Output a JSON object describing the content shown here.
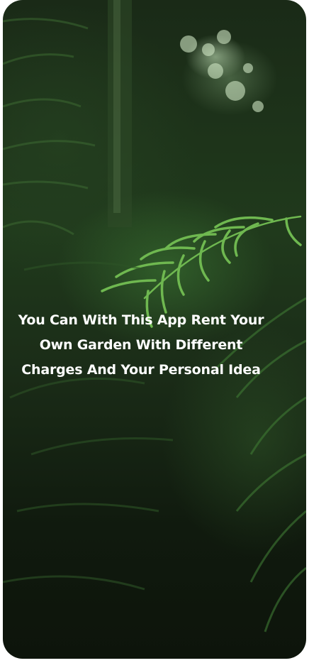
{
  "onboarding": {
    "caption_lines": [
      "You Can With This App Rent Your",
      "Own Garden With Different",
      "Charges And Your Personal Idea"
    ]
  },
  "colors": {
    "caption_text": "#ffffff",
    "page_background": "#ffffff",
    "foliage_dark": "#1b2d18",
    "foliage_light": "#5fa34a"
  }
}
